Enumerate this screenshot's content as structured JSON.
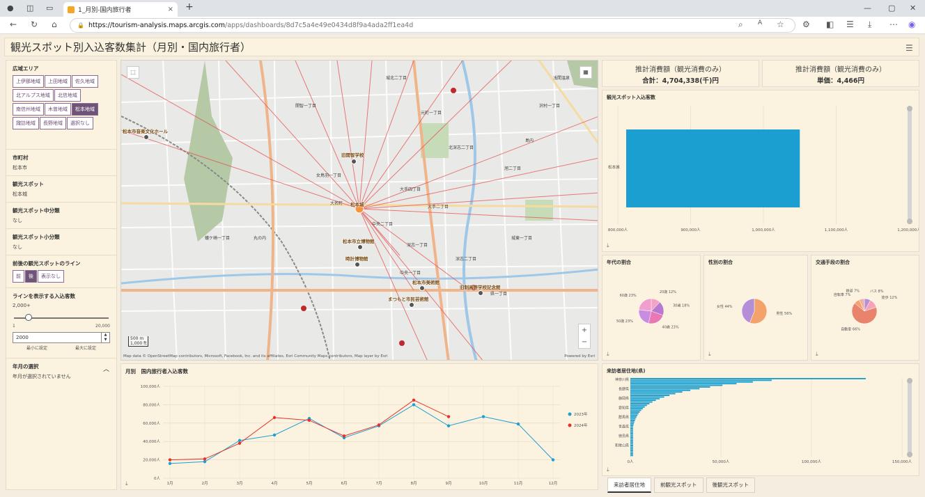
{
  "browser": {
    "tab_title": "1_月別-国内旅行者",
    "url_host": "https://tourism-analysis.maps.arcgis.com",
    "url_path": "/apps/dashboards/8d7c5a4e49e0434d8f9a4ada2ff1ea4d"
  },
  "dashboard": {
    "title": "観光スポット別入込客数集計（月別・国内旅行者）"
  },
  "sidebar": {
    "area_label": "広域エリア",
    "areas": [
      "上伊那地域",
      "上田地域",
      "佐久地域",
      "北アルプス地域",
      "北信地域",
      "南信州地域",
      "木曽地域",
      "松本地域",
      "諏訪地域",
      "長野地域",
      "選択なし"
    ],
    "area_selected": "松本地域",
    "city_label": "市町村",
    "city_value": "松本市",
    "spot_label": "観光スポット",
    "spot_value": "松本城",
    "mid_label": "観光スポット中分類",
    "mid_value": "なし",
    "small_label": "観光スポット小分類",
    "small_value": "なし",
    "line_label": "前後の観光スポットのライン",
    "line_buttons": [
      "前",
      "後",
      "表示なし"
    ],
    "line_selected": "後",
    "threshold_label": "ラインを表示する入込客数",
    "threshold_sub": "2,000+",
    "slider_min": "1",
    "slider_max": "20,000",
    "threshold_input": "2000",
    "set_min": "最小に設定",
    "set_max": "最大に設定",
    "month_label": "年月の選択",
    "month_value": "年月が選択されていません"
  },
  "map": {
    "pois": [
      "松本市音楽文化ホール",
      "旧開智学校",
      "松本城",
      "松本市立博物館",
      "時計博物館",
      "松本市美術館",
      "旧制高等学校記念館",
      "まつもと市民芸術館"
    ],
    "attribution": "Map data © OpenStreetMap contributors, Microsoft, Facebook, Inc. and its affiliates, Esri Community Maps contributors, Map layer by Esri",
    "powered": "Powered by Esri",
    "scale_m": "500 m",
    "scale_ft": "1,000 ft",
    "labels": [
      "城北二丁目",
      "開智一丁目",
      "大手四丁目",
      "中央二丁目",
      "深志一丁目",
      "城東一丁目",
      "北深志二丁目",
      "大手二丁目",
      "中央一丁目",
      "丸の内",
      "大名町",
      "女鳥羽一丁目",
      "旭二丁目",
      "県一丁目",
      "沢村一丁目",
      "元町一丁目",
      "蟻ケ崎一丁目",
      "深志二丁目",
      "島内",
      "浅間温泉"
    ]
  },
  "kpi": [
    {
      "title": "推計消費額（観光消費のみ）",
      "value": "合計：4,704,338(千)円"
    },
    {
      "title": "推計消費額（観光消費のみ）",
      "value": "単価：4,466円"
    }
  ],
  "bar_chart": {
    "title": "観光スポット入込客数"
  },
  "pies": {
    "age": "年代の割合",
    "gender": "性別の割合",
    "transport": "交通手段の割合"
  },
  "residence": {
    "title": "来訪者居住地(県)"
  },
  "bottom_tabs": [
    "来訪者居住地",
    "前観光スポット",
    "後観光スポット"
  ],
  "linechart_title": "月別　国内旅行者入込客数",
  "chart_data": [
    {
      "type": "bar",
      "title": "観光スポット入込客数",
      "categories": [
        "松本城"
      ],
      "values": [
        1050000
      ],
      "xlim": [
        800000,
        1200000
      ],
      "ticks": [
        "800,000人",
        "900,000人",
        "1,000,000人",
        "1,100,000人",
        "1,200,000人"
      ]
    },
    {
      "type": "line",
      "title": "月別　国内旅行者入込客数",
      "categories": [
        "1月",
        "2月",
        "3月",
        "4月",
        "5月",
        "6月",
        "7月",
        "8月",
        "9月",
        "10月",
        "11月",
        "12月"
      ],
      "series": [
        {
          "name": "2023年",
          "color": "#1f9ed1",
          "values": [
            16000,
            18000,
            41000,
            47000,
            65000,
            44000,
            57000,
            80000,
            57000,
            67000,
            59000,
            20000
          ]
        },
        {
          "name": "2024年",
          "color": "#e8312a",
          "values": [
            20000,
            21000,
            38000,
            66000,
            63000,
            46000,
            58000,
            85000,
            67000,
            null,
            null,
            null
          ]
        }
      ],
      "ylim": [
        0,
        100000
      ],
      "yticks": [
        "0人",
        "20,000人",
        "40,000人",
        "60,000人",
        "80,000人",
        "100,000人"
      ]
    },
    {
      "type": "pie",
      "title": "年代の割合",
      "slices": [
        {
          "label": "20歳 12%",
          "value": 12
        },
        {
          "label": "30歳 18%",
          "value": 18
        },
        {
          "label": "40歳 23%",
          "value": 23
        },
        {
          "label": "50歳 23%",
          "value": 23
        },
        {
          "label": "60歳 23%",
          "value": 23
        }
      ]
    },
    {
      "type": "pie",
      "title": "性別の割合",
      "slices": [
        {
          "label": "男性 56%",
          "value": 56
        },
        {
          "label": "女性 44%",
          "value": 44
        }
      ]
    },
    {
      "type": "pie",
      "title": "交通手段の割合",
      "slices": [
        {
          "label": "バス 8%",
          "value": 8
        },
        {
          "label": "徒歩 12%",
          "value": 12
        },
        {
          "label": "自動車 66%",
          "value": 66
        },
        {
          "label": "自転車 7%",
          "value": 7
        },
        {
          "label": "鉄道 7%",
          "value": 7
        }
      ]
    },
    {
      "type": "bar",
      "title": "来訪者居住地(県)",
      "categories": [
        "神奈川県",
        "長野県",
        "静岡県",
        "愛知県",
        "群馬県",
        "青森県",
        "徳島県",
        "和歌山県"
      ],
      "xticks": [
        "0人",
        "50,000人",
        "100,000人",
        "150,000人"
      ],
      "xlim": [
        0,
        150000
      ]
    }
  ]
}
